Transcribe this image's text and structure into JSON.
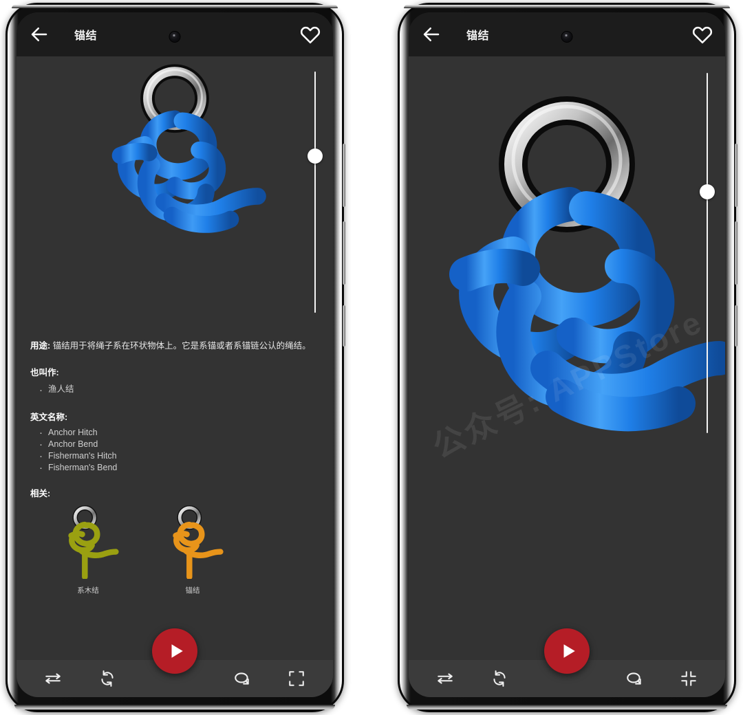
{
  "app": {
    "header": {
      "back_icon": "arrow-left-icon",
      "title": "锚结",
      "favorite_icon": "heart-outline-icon"
    },
    "viewer": {
      "background_color": "#333333",
      "rope_color": "#1f7fe8",
      "ring_color": "#d9d9d9",
      "slider_value_percent": 35
    },
    "watermark": "公众号: APPStore",
    "content": {
      "usage_label": "用途:",
      "usage_text": "锚结用于将绳子系在环状物体上。它是系锚或者系锚链公认的绳结。",
      "aka_heading": "也叫作:",
      "aka_items": [
        "渔人结"
      ],
      "english_heading": "英文名称:",
      "english_items": [
        "Anchor Hitch",
        "Anchor Bend",
        "Fisherman's Hitch",
        "Fisherman's Bend"
      ],
      "related_heading": "相关:",
      "related_items": [
        {
          "label": "系木结",
          "color": "#9aa011"
        },
        {
          "label": "锚结",
          "color": "#e8941a"
        }
      ]
    },
    "toolbar": {
      "mirror_label": "mirror-icon",
      "rotate_label": "refresh-icon",
      "play_label": "play-icon",
      "spin_label": "rotate-3d-icon",
      "fullscreen_label": "fullscreen-expand-icon",
      "fullscreen_exit_label": "fullscreen-collapse-icon",
      "fab_color": "#b51d26"
    }
  },
  "panels": {
    "left": {
      "mode": "detail",
      "fullscreen_icon": "fullscreen-expand-icon"
    },
    "right": {
      "mode": "fullscreen",
      "fullscreen_icon": "fullscreen-collapse-icon"
    }
  }
}
